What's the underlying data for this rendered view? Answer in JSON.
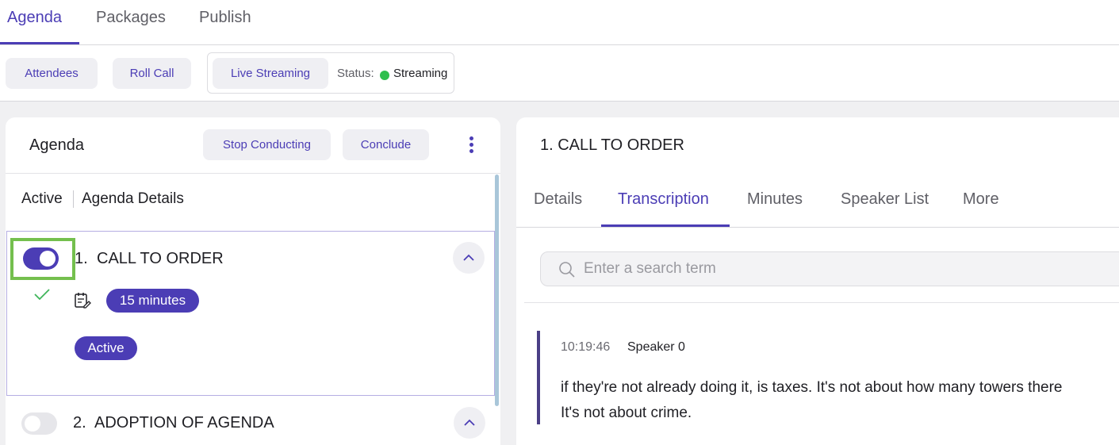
{
  "top_nav": {
    "tabs": [
      {
        "label": "Agenda",
        "active": true
      },
      {
        "label": "Packages",
        "active": false
      },
      {
        "label": "Publish",
        "active": false
      }
    ]
  },
  "toolbar": {
    "attendees_label": "Attendees",
    "roll_call_label": "Roll Call",
    "live_streaming_label": "Live Streaming",
    "status_label": "Status:",
    "status_value": "Streaming",
    "status_color": "#2fbf4e"
  },
  "agenda_panel": {
    "title": "Agenda",
    "stop_conducting_label": "Stop Conducting",
    "conclude_label": "Conclude",
    "menu_icon": "kebab-vertical-icon",
    "subtabs": [
      {
        "label": "Active"
      },
      {
        "label": "Agenda Details"
      }
    ],
    "items": [
      {
        "number": "1.",
        "title": "CALL TO ORDER",
        "enabled": true,
        "completed_icon": "check-icon",
        "notes_icon": "notes-edit-icon",
        "duration": "15 minutes",
        "status": "Active",
        "expand_icon": "chevron-up-icon"
      },
      {
        "number": "2.",
        "title": "ADOPTION OF AGENDA",
        "enabled": false,
        "expand_icon": "chevron-up-icon"
      }
    ]
  },
  "detail_panel": {
    "title": "1. CALL TO ORDER",
    "tabs": [
      {
        "label": "Details",
        "active": false
      },
      {
        "label": "Transcription",
        "active": true
      },
      {
        "label": "Minutes",
        "active": false
      },
      {
        "label": "Speaker List",
        "active": false
      },
      {
        "label": "More",
        "active": false
      }
    ],
    "search": {
      "placeholder": "Enter a search term",
      "value": "",
      "icon": "search-icon"
    },
    "transcript": [
      {
        "time": "10:19:46",
        "speaker": "Speaker 0",
        "line1": "if they're not already doing it, is taxes. It's not about how many towers there",
        "line2": "It's not about crime."
      }
    ]
  },
  "colors": {
    "accent": "#4b3db5",
    "highlight_border": "#74bf4e",
    "panel_background": "#f0f0f2"
  }
}
